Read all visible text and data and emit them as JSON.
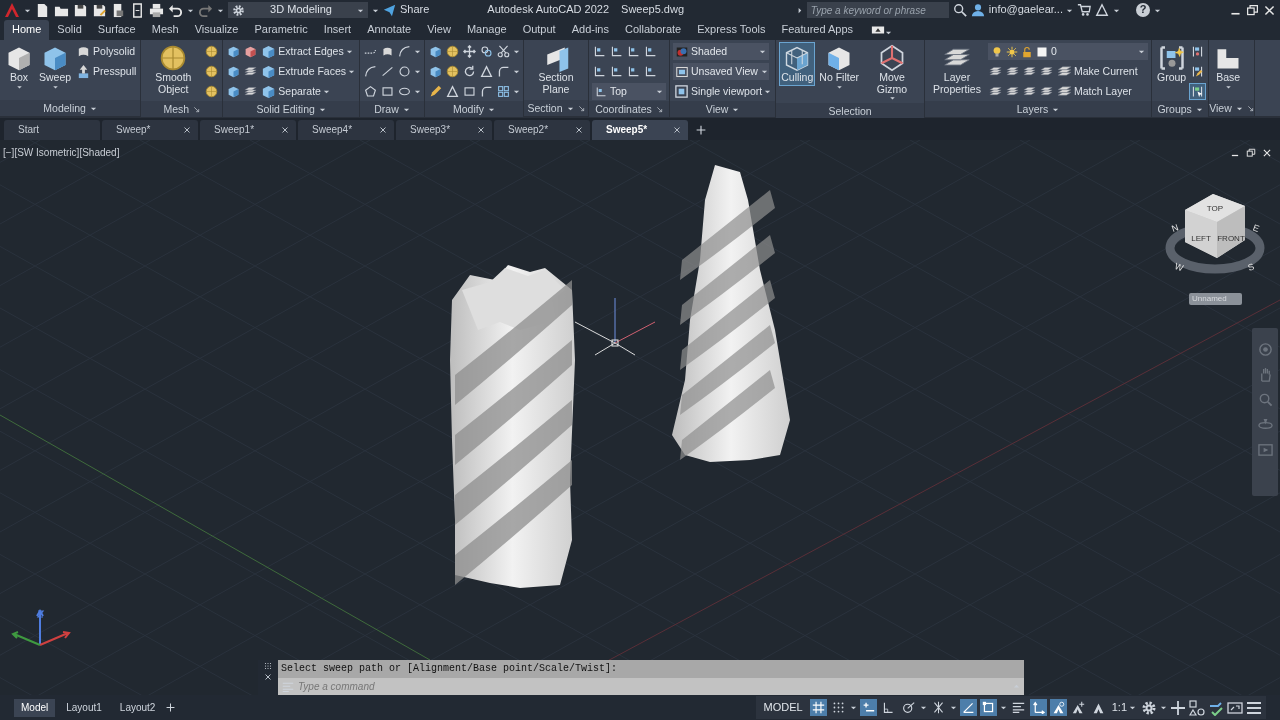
{
  "title_bar": {
    "workspace": "3D Modeling",
    "share": "Share",
    "title": "Autodesk AutoCAD 2022",
    "file": "Sweep5.dwg",
    "search": {
      "placeholder": "Type a keyword or phrase"
    },
    "user": "info@gaelear...",
    "help": "?"
  },
  "ribbon_tabs": [
    {
      "label": "Home",
      "selected": true
    },
    {
      "label": "Solid",
      "selected": false
    },
    {
      "label": "Surface",
      "selected": false
    },
    {
      "label": "Mesh",
      "selected": false
    },
    {
      "label": "Visualize",
      "selected": false
    },
    {
      "label": "Parametric",
      "selected": false
    },
    {
      "label": "Insert",
      "selected": false
    },
    {
      "label": "Annotate",
      "selected": false
    },
    {
      "label": "View",
      "selected": false
    },
    {
      "label": "Manage",
      "selected": false
    },
    {
      "label": "Output",
      "selected": false
    },
    {
      "label": "Add-ins",
      "selected": false
    },
    {
      "label": "Collaborate",
      "selected": false
    },
    {
      "label": "Express Tools",
      "selected": false
    },
    {
      "label": "Featured Apps",
      "selected": false
    }
  ],
  "ribbon_panels": [
    {
      "title": "Modeling",
      "tools": [
        {
          "kind": "large",
          "label": "Box",
          "on": false
        },
        {
          "kind": "large",
          "label": "Sweep",
          "on": false
        },
        {
          "kind": "row",
          "label": "Polysolid"
        },
        {
          "kind": "row",
          "label": "Presspull"
        }
      ]
    },
    {
      "title": "Mesh",
      "tools": [
        {
          "kind": "large",
          "label": "Smooth Object",
          "on": false
        },
        {
          "kind": "row"
        },
        {
          "kind": "row"
        },
        {
          "kind": "row"
        }
      ]
    },
    {
      "title": "Solid Editing",
      "tools": [
        {
          "kind": "row",
          "label": "Extract Edges"
        },
        {
          "kind": "row",
          "label": "Extrude Faces"
        },
        {
          "kind": "row",
          "label": "Separate"
        }
      ]
    },
    {
      "title": "Draw",
      "tools": [
        {
          "kind": "row"
        },
        {
          "kind": "row"
        },
        {
          "kind": "row"
        }
      ]
    },
    {
      "title": "Modify",
      "tools": [
        {
          "kind": "row"
        },
        {
          "kind": "row"
        },
        {
          "kind": "row"
        }
      ]
    },
    {
      "title": "Section",
      "tools": [
        {
          "kind": "large",
          "label": "Section Plane",
          "on": false
        }
      ]
    },
    {
      "title": "Coordinates",
      "tools": [
        {
          "kind": "row"
        },
        {
          "kind": "row"
        },
        {
          "kind": "row",
          "combo": "Top"
        }
      ]
    },
    {
      "title": "View",
      "tools": [
        {
          "kind": "row",
          "combo": "Shaded"
        },
        {
          "kind": "row",
          "combo": "Unsaved View"
        },
        {
          "kind": "row",
          "label": "Single viewport"
        }
      ]
    },
    {
      "title": "Selection",
      "tools": [
        {
          "kind": "large",
          "label": "Culling",
          "on": true
        },
        {
          "kind": "large",
          "label": "No Filter",
          "on": false
        },
        {
          "kind": "large",
          "label": "Move Gizmo",
          "on": false
        }
      ]
    },
    {
      "title": "Layers",
      "tools": [
        {
          "kind": "large",
          "label": "Layer Properties",
          "on": false
        },
        {
          "kind": "row",
          "combo": "0"
        },
        {
          "kind": "row",
          "label": "Make Current"
        },
        {
          "kind": "row",
          "label": "Match Layer"
        }
      ]
    },
    {
      "title": "Groups",
      "tools": [
        {
          "kind": "large",
          "label": "Group",
          "on": false
        },
        {
          "kind": "row",
          "on": false
        },
        {
          "kind": "row",
          "on": false
        },
        {
          "kind": "row",
          "on": true
        }
      ]
    },
    {
      "title": "View",
      "tools": [
        {
          "kind": "large",
          "label": "Base",
          "on": false
        }
      ]
    }
  ],
  "document_tabs": [
    {
      "label": "Start",
      "selected": false,
      "closable": false
    },
    {
      "label": "Sweep*",
      "selected": false,
      "closable": true
    },
    {
      "label": "Sweep1*",
      "selected": false,
      "closable": true
    },
    {
      "label": "Sweep4*",
      "selected": false,
      "closable": true
    },
    {
      "label": "Sweep3*",
      "selected": false,
      "closable": true
    },
    {
      "label": "Sweep2*",
      "selected": false,
      "closable": true
    },
    {
      "label": "Sweep5*",
      "selected": true,
      "closable": true
    }
  ],
  "viewport": {
    "label": "[−][SW Isometric][Shaded]",
    "viewcube": {
      "top": "TOP",
      "left": "LEFT",
      "front": "FRONT",
      "compass": [
        "N",
        "E",
        "S",
        "W"
      ]
    },
    "ucs_name": "Unnamed"
  },
  "command_line": {
    "history": "Select sweep path or [Alignment/Base point/Scale/Twist]:",
    "placeholder": "Type a command"
  },
  "status_bar": {
    "layouts": [
      {
        "label": "Model",
        "selected": true
      },
      {
        "label": "Layout1",
        "selected": false
      },
      {
        "label": "Layout2",
        "selected": false
      }
    ],
    "model": "MODEL",
    "toggles": [
      {
        "on": true
      },
      {
        "on": false
      },
      {
        "on": true
      },
      {
        "on": false
      },
      {
        "on": false
      },
      {
        "on": false
      },
      {
        "on": true
      },
      {
        "on": true
      },
      {
        "on": false
      },
      {
        "on": true
      },
      {
        "on": true
      },
      {
        "on": false
      },
      {
        "on": false
      }
    ],
    "scale": "1:1"
  }
}
